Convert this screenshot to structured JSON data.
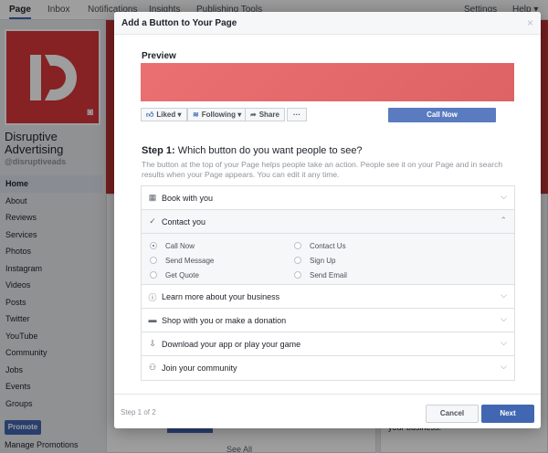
{
  "topnav": {
    "tabs": [
      "Page",
      "Inbox",
      "Notifications",
      "Insights",
      "Publishing Tools"
    ],
    "settings": "Settings",
    "help": "Help ▾"
  },
  "page": {
    "name": "Disruptive Advertising",
    "handle": "@disruptiveads",
    "menu": [
      "Home",
      "About",
      "Reviews",
      "Services",
      "Photos",
      "Instagram",
      "Videos",
      "Posts",
      "Twitter",
      "YouTube",
      "Community",
      "Jobs",
      "Events",
      "Groups"
    ],
    "promote": "Promote",
    "manage_promotions": "Manage Promotions",
    "see_all": "See All",
    "bg_text_right": "your business."
  },
  "modal": {
    "title": "Add a Button to Your Page",
    "close": "×",
    "preview_label": "Preview",
    "preview_buttons": {
      "liked": "Liked ▾",
      "following": "Following ▾",
      "share": "Share",
      "more": "···"
    },
    "call_now": "Call Now",
    "step_prefix": "Step 1:",
    "step_question": "Which button do you want people to see?",
    "step_description": "The button at the top of your Page helps people take an action. People see it on your Page and in search results when your Page appears. You can edit it any time.",
    "options": [
      {
        "label": "Book with you",
        "icon": "calendar-icon",
        "open": false
      },
      {
        "label": "Contact you",
        "icon": "check-icon",
        "open": true
      },
      {
        "label": "Learn more about your business",
        "icon": "info-icon",
        "open": false
      },
      {
        "label": "Shop with you or make a donation",
        "icon": "bag-icon",
        "open": false
      },
      {
        "label": "Download your app or play your game",
        "icon": "download-icon",
        "open": false
      },
      {
        "label": "Join your community",
        "icon": "people-icon",
        "open": false
      }
    ],
    "contact_choices": [
      {
        "label": "Call Now",
        "selected": true
      },
      {
        "label": "Contact Us",
        "selected": false
      },
      {
        "label": "Send Message",
        "selected": false
      },
      {
        "label": "Sign Up",
        "selected": false
      },
      {
        "label": "Get Quote",
        "selected": false
      },
      {
        "label": "Send Email",
        "selected": false
      }
    ],
    "footer_step": "Step 1 of 2",
    "cancel": "Cancel",
    "next": "Next"
  },
  "colors": {
    "brand_blue": "#4267b2",
    "cover_red": "#d9383a",
    "preview_red": "#e9686a"
  }
}
